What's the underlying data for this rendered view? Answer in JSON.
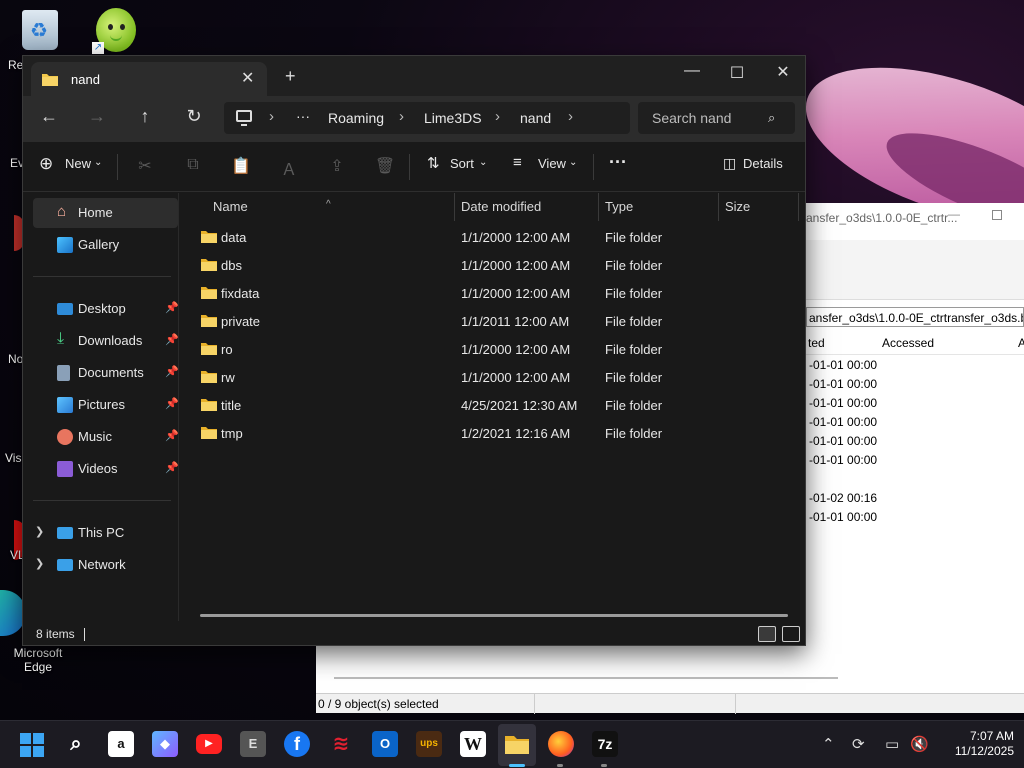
{
  "desktop": {
    "icons": {
      "recycle_bin_peek": "Re",
      "peek_ev": "Ev",
      "peek_no": "No",
      "peek_vis": "Vis",
      "peek_vl": "VL",
      "edge_label": "Microsoft Edge"
    }
  },
  "background_window": {
    "title": "ansfer_o3ds\\1.0.0-0E_ctrtr...",
    "path": "ansfer_o3ds\\1.0.0-0E_ctrtransfer_o3ds.bin",
    "columns": [
      "ted",
      "Accessed",
      "A"
    ],
    "rows": [
      "-01-01 00:00",
      "-01-01 00:00",
      "-01-01 00:00",
      "-01-01 00:00",
      "-01-01 00:00",
      "-01-01 00:00",
      "",
      "-01-02 00:16",
      "-01-01 00:00"
    ],
    "status": "0 / 9 object(s) selected"
  },
  "explorer": {
    "tab_title": "nand",
    "breadcrumb": {
      "more": "···",
      "items": [
        "Roaming",
        "Lime3DS",
        "nand"
      ]
    },
    "search_placeholder": "Search nand",
    "toolbar": {
      "new_label": "New",
      "sort_label": "Sort",
      "view_label": "View",
      "more_label": "···",
      "details_label": "Details"
    },
    "sidebar": {
      "home": "Home",
      "gallery": "Gallery",
      "desktop": "Desktop",
      "downloads": "Downloads",
      "documents": "Documents",
      "pictures": "Pictures",
      "music": "Music",
      "videos": "Videos",
      "this_pc": "This PC",
      "network": "Network"
    },
    "columns": {
      "name": "Name",
      "date": "Date modified",
      "type": "Type",
      "size": "Size"
    },
    "files": [
      {
        "name": "data",
        "date": "1/1/2000 12:00 AM",
        "type": "File folder"
      },
      {
        "name": "dbs",
        "date": "1/1/2000 12:00 AM",
        "type": "File folder"
      },
      {
        "name": "fixdata",
        "date": "1/1/2000 12:00 AM",
        "type": "File folder"
      },
      {
        "name": "private",
        "date": "1/1/2011 12:00 AM",
        "type": "File folder"
      },
      {
        "name": "ro",
        "date": "1/1/2000 12:00 AM",
        "type": "File folder"
      },
      {
        "name": "rw",
        "date": "1/1/2000 12:00 AM",
        "type": "File folder"
      },
      {
        "name": "title",
        "date": "4/25/2021 12:30 AM",
        "type": "File folder"
      },
      {
        "name": "tmp",
        "date": "1/2/2021 12:16 AM",
        "type": "File folder"
      }
    ],
    "status": "8 items"
  },
  "taskbar": {
    "clock_time": "7:07 AM",
    "clock_date": "11/12/2025"
  },
  "colors": {
    "folder": "#f2c84b",
    "accent": "#4cc2ff"
  }
}
